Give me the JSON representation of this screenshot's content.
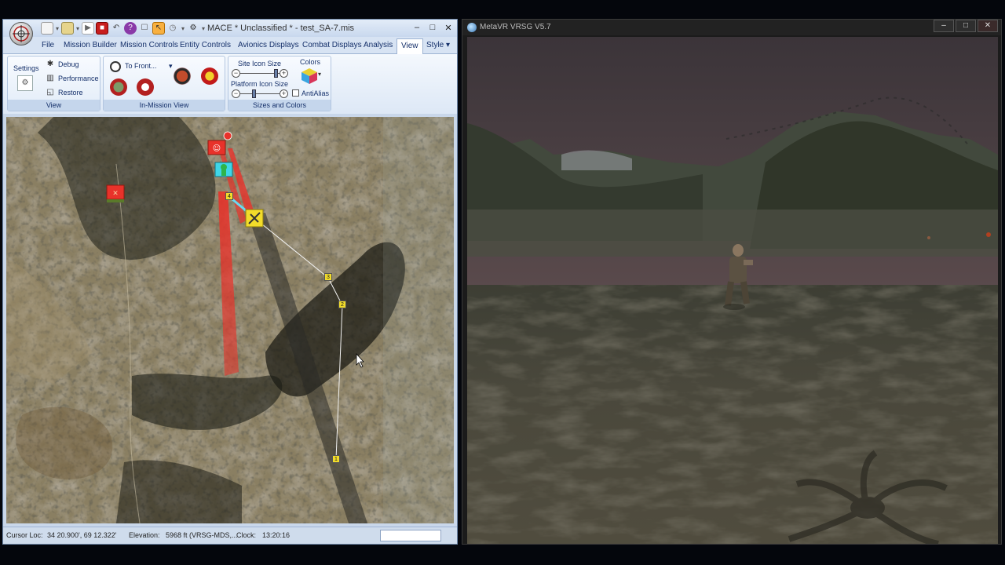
{
  "mace": {
    "title": "MACE  * Unclassified * - test_SA-7.mis",
    "tabs": [
      {
        "label": "File"
      },
      {
        "label": "Mission Builder"
      },
      {
        "label": "Mission Controls"
      },
      {
        "label": "Entity Controls"
      },
      {
        "label": "Avionics Displays"
      },
      {
        "label": "Combat Displays"
      },
      {
        "label": "Analysis"
      },
      {
        "label": "View"
      }
    ],
    "style_menu": "Style",
    "ribbon": {
      "view_group": {
        "label": "View",
        "settings": "Settings",
        "debug": "Debug",
        "performance": "Performance",
        "restore": "Restore"
      },
      "in_mission_group": {
        "label": "In-Mission View",
        "to_front": "To Front..."
      },
      "sizes_group": {
        "label": "Sizes and Colors",
        "site_icon_size": "Site Icon Size",
        "platform_icon_size": "Platform Icon Size",
        "colors": "Colors",
        "antialias": "AntiAlias"
      }
    },
    "map": {
      "waypoints": [
        "4",
        "3",
        "2",
        "1"
      ]
    },
    "status": {
      "cursor_label": "Cursor Loc:",
      "cursor_value": "34 20.900', 69 12.322'",
      "elevation_label": "Elevation:",
      "elevation_value": "5968 ft (VRSG-MDS,...",
      "clock_label": "Clock:",
      "clock_value": "13:20:16"
    }
  },
  "vrsg": {
    "title": "MetaVR VRSG V5.7"
  },
  "colors": {
    "ribbon_blue": "#15306a",
    "threat_red": "#e8322a",
    "waypoint_yellow": "#f2dc2a",
    "friendly_cyan": "#3fd6e8"
  }
}
